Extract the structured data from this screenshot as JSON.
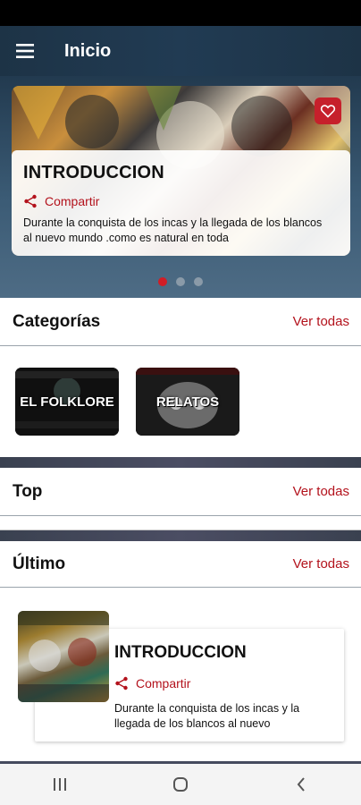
{
  "appbar": {
    "title": "Inicio",
    "menu_icon": "menu-icon"
  },
  "hero": {
    "slide": {
      "title": "INTRODUCCION",
      "share_label": "Compartir",
      "description": "Durante la conquista de los incas y la llegada de los blancos al nuevo mundo .como es natural en toda",
      "favorite_icon": "heart-icon"
    },
    "dots": {
      "count": 3,
      "active_index": 0
    }
  },
  "categories": {
    "title": "Categorías",
    "see_all": "Ver todas",
    "items": [
      {
        "label": "EL FOLKLORE"
      },
      {
        "label": "RELATOS"
      }
    ]
  },
  "top": {
    "title": "Top",
    "see_all": "Ver todas"
  },
  "latest": {
    "title": "Último",
    "see_all": "Ver todas",
    "card": {
      "title": "INTRODUCCION",
      "share_label": "Compartir",
      "description": "Durante la conquista de los incas y la llegada de los blancos al nuevo"
    }
  },
  "colors": {
    "accent": "#b3121c",
    "appbar": "#1d3346",
    "favorite": "#c6202b"
  }
}
